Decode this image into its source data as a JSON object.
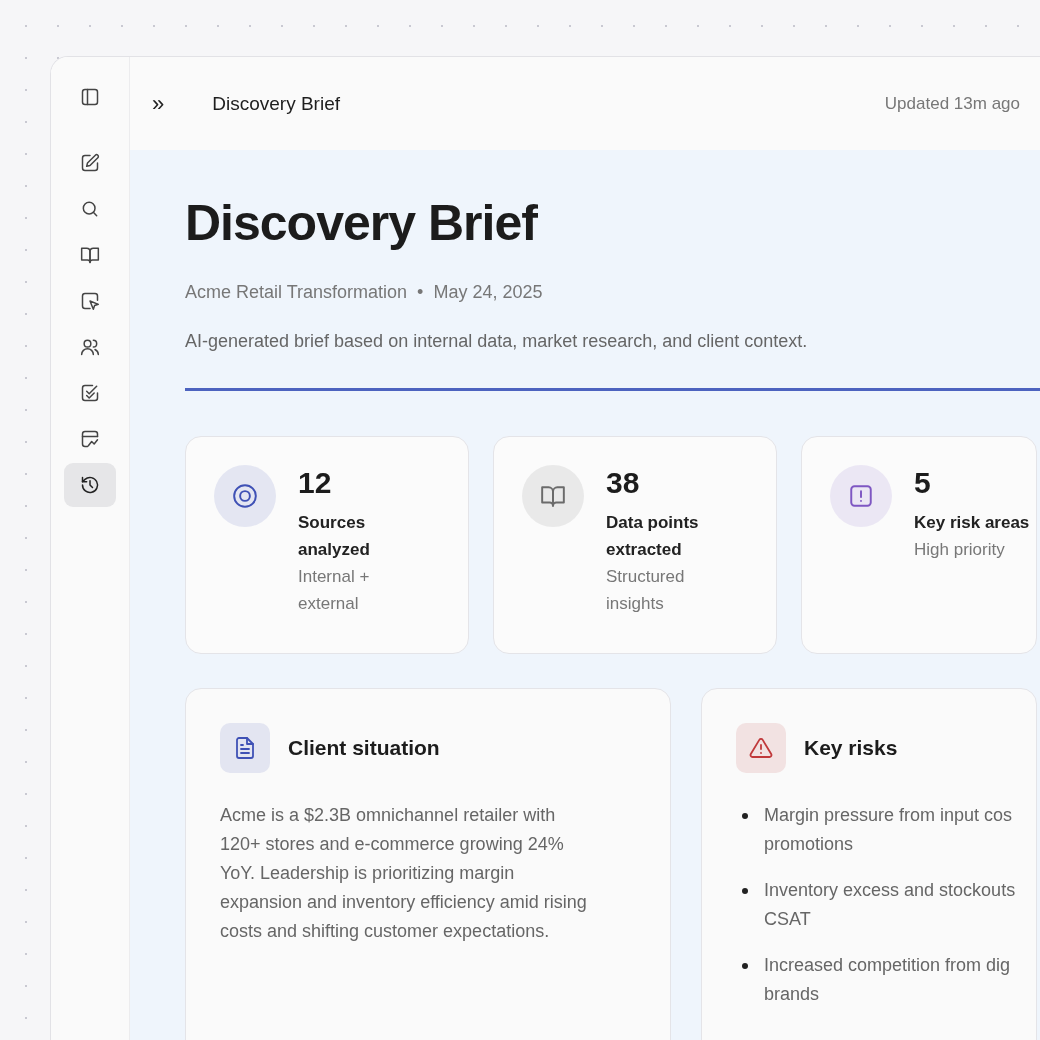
{
  "sidebar": {
    "items": [
      {
        "selected": false
      },
      {
        "selected": false
      },
      {
        "selected": false
      },
      {
        "selected": false
      },
      {
        "selected": false
      },
      {
        "selected": false
      },
      {
        "selected": false
      },
      {
        "selected": false
      },
      {
        "selected": true
      }
    ]
  },
  "header": {
    "expand_icon": "»",
    "title": "Discovery Brief",
    "updated": "Updated 13m ago"
  },
  "page": {
    "title": "Discovery Brief",
    "client": "Acme Retail Transformation",
    "separator": "•",
    "date": "May 24, 2025",
    "description": "AI-generated brief based on internal data, market research, and client context."
  },
  "stats": [
    {
      "kind": "target",
      "color": "#3f51b5",
      "value": "12",
      "label": "Sources analyzed",
      "note": "Internal + external"
    },
    {
      "kind": "book",
      "color": "#6b6b6b",
      "value": "38",
      "label": "Data points extracted",
      "note": "Structured insights"
    },
    {
      "kind": "alert",
      "color": "#7e57c2",
      "value": "5",
      "label": "Key risk areas",
      "note": "High priority"
    }
  ],
  "sections": [
    {
      "kind": "paragraph",
      "color": "#3f51b5",
      "title": "Client situation",
      "text": "Acme is a $2.3B omnichannel retailer with 120+ stores and e-commerce growing 24% YoY. Leadership is prioritizing margin expansion and inventory efficiency amid rising costs and shifting customer expectations."
    },
    {
      "kind": "bullets",
      "color": "#c0393b",
      "title": "Key risks",
      "items": [
        [
          "Margin pressure from input cos",
          "promotions"
        ],
        [
          "Inventory excess and stockouts",
          "CSAT"
        ],
        [
          "Increased competition from dig",
          "brands"
        ]
      ]
    }
  ]
}
